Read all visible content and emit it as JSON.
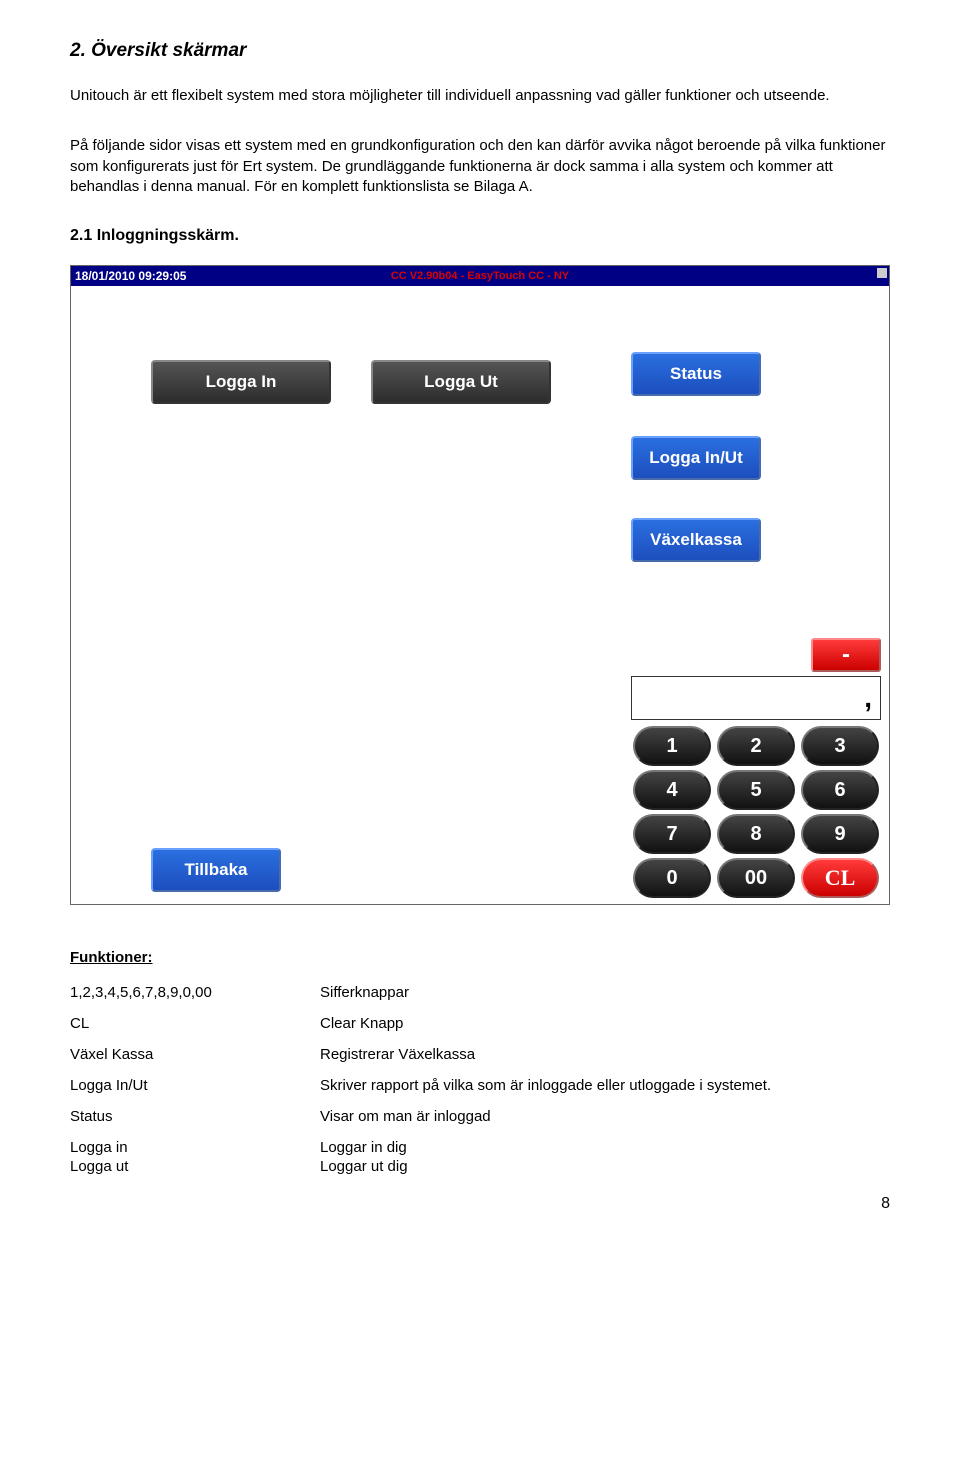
{
  "section_title": "2. Översikt  skärmar",
  "para1": "Unitouch är ett flexibelt system med stora möjligheter till individuell anpassning vad gäller funktioner och utseende.",
  "para2": "På följande sidor visas ett system med en grundkonfiguration och den kan därför avvika något beroende på vilka funktioner som konfigurerats just för Ert system. De grundläggande funktionerna är dock samma i alla system och kommer att behandlas i denna manual. För en komplett funktionslista se Bilaga A.",
  "subsection": "2.1 Inloggningsskärm.",
  "titlebar_left": "18/01/2010 09:29:05",
  "titlebar_center": "CC V2.90b04  -  EasyTouch CC  -  NY",
  "buttons": {
    "logga_in": "Logga In",
    "logga_ut": "Logga Ut",
    "status": "Status",
    "logga_in_ut": "Logga In/Ut",
    "vaxelkassa": "Växelkassa",
    "tillbaka": "Tillbaka",
    "minus": "-",
    "display": ","
  },
  "keypad": [
    "1",
    "2",
    "3",
    "4",
    "5",
    "6",
    "7",
    "8",
    "9",
    "0",
    "00",
    "CL"
  ],
  "functions_heading": "Funktioner:",
  "functions": [
    {
      "l": "1,2,3,4,5,6,7,8,9,0,00",
      "r": "Sifferknappar"
    },
    {
      "l": "CL",
      "r": "Clear Knapp"
    },
    {
      "l": "Växel Kassa",
      "r": "Registrerar Växelkassa"
    },
    {
      "l": "Logga In/Ut",
      "r": "Skriver rapport på vilka som är inloggade eller utloggade i systemet."
    },
    {
      "l": "Status",
      "r": "Visar om man är inloggad"
    },
    {
      "l": "Logga in",
      "r": "Loggar in dig"
    },
    {
      "l": "Logga ut",
      "r": "Loggar ut dig"
    }
  ],
  "page_number": "8"
}
